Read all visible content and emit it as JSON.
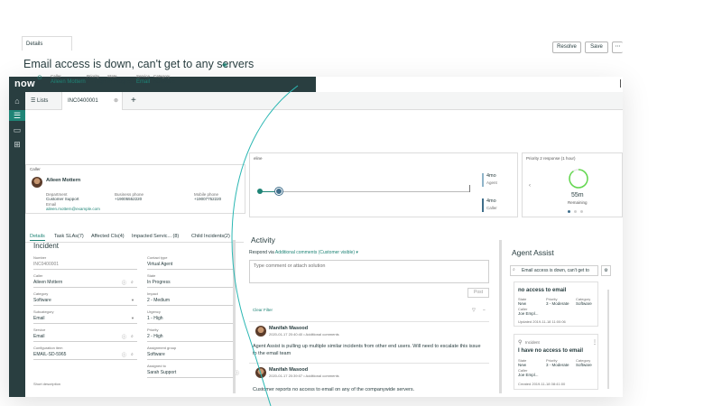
{
  "app": {
    "logo": "now"
  },
  "tabs": {
    "lists": "Lists",
    "record": "INC0400001",
    "close": "⊗",
    "add": "+"
  },
  "subtab": "Details",
  "actions": {
    "resolve": "Resolve",
    "save": "Save",
    "more": "⋯"
  },
  "record": {
    "title": "Email access is down, can't get to any servers",
    "caller_label": "Caller",
    "caller": "Aileen Mottern",
    "priority_label": "Priority",
    "priority": "2 - High",
    "state_label": "State",
    "state": "In Progress",
    "service_label": "Service",
    "service": "Email",
    "category_label": "Category",
    "category": "Software"
  },
  "caller_card": {
    "header": "Caller",
    "name": "Aileen Mottern",
    "department_label": "Department",
    "department": "Customer Support",
    "business_phone_label": "Business phone",
    "business_phone": "+19005552220",
    "mobile_phone_label": "Mobile phone",
    "mobile_phone": "+19007752220",
    "email_label": "Email",
    "email": "aileen.mottern@example.com"
  },
  "timeline": {
    "header": "eline",
    "t1_value": "4mo",
    "t1_label": "Agent",
    "t2_value": "4mo",
    "t2_label": "Caller"
  },
  "sla": {
    "header": "Priority 2 response (1 hour)",
    "value": "55m",
    "label": "Remaining",
    "remaining_fraction": 0.9,
    "nav_prev": "‹"
  },
  "form_tabs": [
    "Details",
    "Task SLAs(7)",
    "Affected CIs(4)",
    "Impacted Servic... (8)",
    "Child Incidents(2)"
  ],
  "form": {
    "section": "Incident",
    "number_label": "Number",
    "number": "INC0400001",
    "contact_type_label": "Contact type",
    "contact_type": "Virtual Agent",
    "caller_label": "Caller",
    "caller": "Aileen Mottern",
    "state_label": "State",
    "state": "In Progress",
    "category_label": "Category",
    "category": "Software",
    "impact_label": "Impact",
    "impact": "2 - Medium",
    "subcategory_label": "Subcategory",
    "subcategory": "Email",
    "urgency_label": "Urgency",
    "urgency": "1 - High",
    "service_label": "Service",
    "service": "Email",
    "priority_label": "Priority",
    "priority": "2 - High",
    "ci_label": "Configuration item",
    "ci": "EMAIL-SD-5965",
    "assignment_group_label": "Assignment group",
    "assignment_group": "Software",
    "assigned_to_label": "Assigned to",
    "assigned_to": "Sarah Support",
    "short_desc_label": "Short description"
  },
  "activity": {
    "title": "Activity",
    "respond_prefix": "Respond via",
    "respond_link": "Additional comments (Customer visible)",
    "placeholder": "Type comment or attach solution",
    "post": "Post",
    "clear_filter": "Clear Filter",
    "entries": [
      {
        "name": "Manifah Masood",
        "date": "2020-01-17 20:40:40 • Additional comments",
        "text": "Agent Assist is pulling up multiple similar incidents from other end users. Will need to escalate this issue to the email team"
      },
      {
        "name": "Manifah Masood",
        "date": "2020-01-17 20:39:07 • Additional comments",
        "text": "Customer reports no access to email on any of the companywide servers."
      }
    ]
  },
  "assist": {
    "title": "Agent Assist",
    "search": "Email access is down, can't get to",
    "cards": [
      {
        "type": "",
        "title": "no access to email",
        "state_label": "State",
        "state": "New",
        "priority_label": "Priority",
        "priority": "3 - Moderate",
        "category_label": "Category",
        "category": "Software",
        "caller_label": "Caller",
        "caller": "Joe Empl...",
        "date": "Updated 2019-11-18 11:00:06"
      },
      {
        "type": "Incident",
        "title": "I have no access to email",
        "state_label": "State",
        "state": "New",
        "priority_label": "Priority",
        "priority": "3 - Moderate",
        "category_label": "Category",
        "category": "Software",
        "caller_label": "Caller",
        "caller": "Joe Empl...",
        "date": "Created 2019-11-18 08:41:00"
      }
    ]
  },
  "colors": {
    "dark": "#293e40",
    "accent": "#1f8476",
    "sla_ring": "#62d84e"
  }
}
